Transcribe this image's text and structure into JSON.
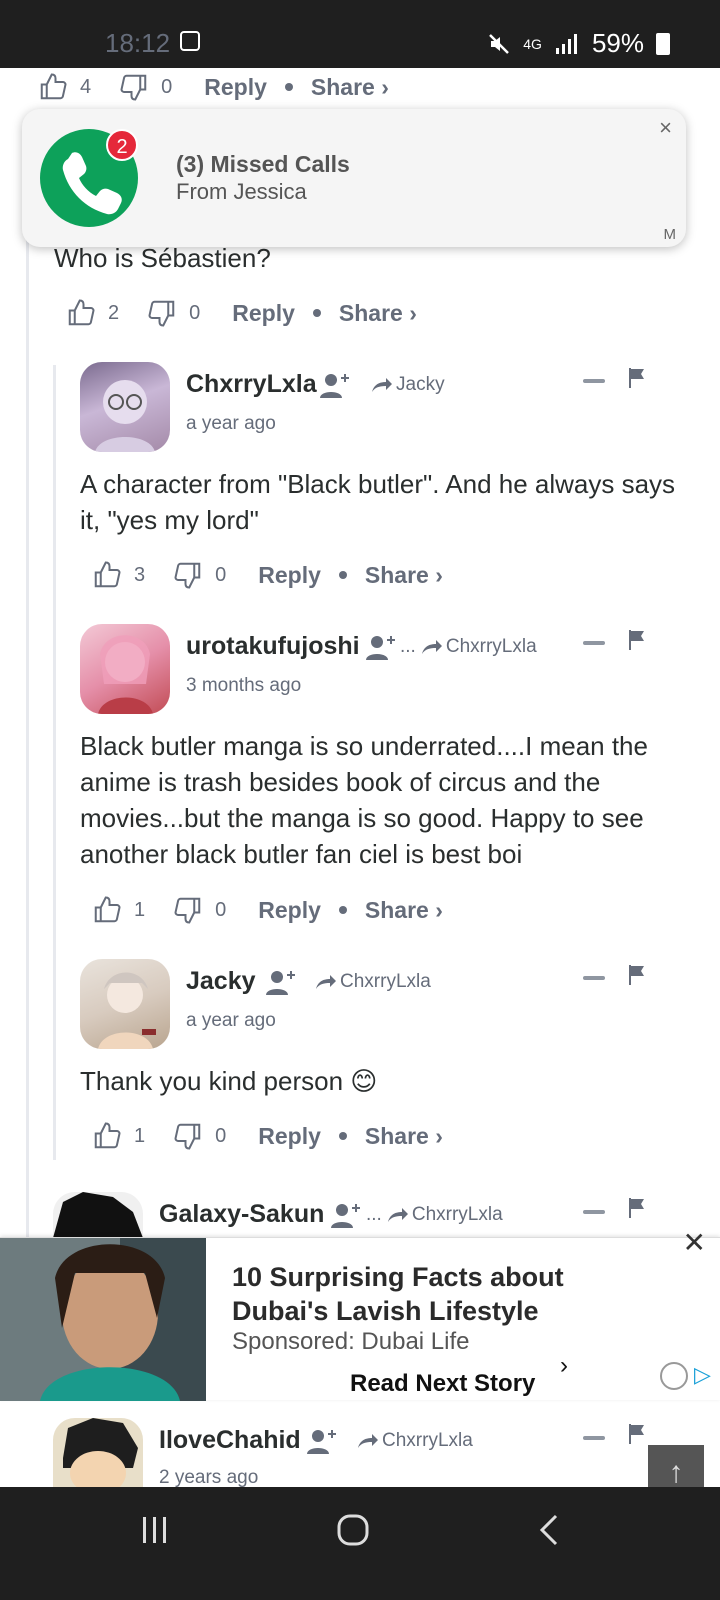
{
  "status_bar": {
    "time": "18:12",
    "network": "4G",
    "battery": "59%"
  },
  "notification": {
    "badge_count": "2",
    "title": "(3) Missed Calls",
    "subtitle": "From Jessica",
    "close": "×",
    "app_glyph": "M"
  },
  "top_actions": {
    "likes": "4",
    "dislikes": "0",
    "reply": "Reply",
    "share": "Share ›"
  },
  "comment_jacky_root": {
    "text": "Who is Sébastien?",
    "likes": "2",
    "dislikes": "0",
    "reply": "Reply",
    "share": "Share ›"
  },
  "comment_chxrry": {
    "author": "ChxrryLxla",
    "reply_to": "Jacky",
    "time": "a year ago",
    "text": "A character from \"Black butler\". And he always says it, \"yes my lord\"",
    "likes": "3",
    "dislikes": "0",
    "reply": "Reply",
    "share": "Share ›"
  },
  "comment_urotaku": {
    "author": "urotakufujoshi",
    "reply_to": "ChxrryLxla",
    "reply_prefix": "...",
    "time": "3 months ago",
    "text": "Black butler manga is so underrated....I mean the anime is trash besides book of circus and the movies...but the manga is so good. Happy to see another black butler fan ciel is best boi",
    "likes": "1",
    "dislikes": "0",
    "reply": "Reply",
    "share": "Share ›"
  },
  "comment_jacky": {
    "author": "Jacky",
    "reply_to": "ChxrryLxla",
    "time": "a year ago",
    "text": "Thank you kind person 😊",
    "likes": "1",
    "dislikes": "0",
    "reply": "Reply",
    "share": "Share ›"
  },
  "comment_galaxy": {
    "author": "Galaxy-Sakun",
    "reply_to": "ChxrryLxla",
    "reply_prefix": "..."
  },
  "ad": {
    "headline": "10 Surprising Facts about Dubai's Lavish Lifestyle",
    "sponsor": "Sponsored: Dubai Life",
    "cta": "Read Next Story",
    "chevron": "›",
    "close": "✕",
    "adchoice": "▷"
  },
  "comment_ilove": {
    "author": "IloveChahid",
    "reply_to": "ChxrryLxla",
    "time": "2 years ago"
  },
  "scroll_top": "↑",
  "colors": {
    "accent": "#0da15a",
    "badge": "#e5283a",
    "bar": "#1f1f1f"
  }
}
